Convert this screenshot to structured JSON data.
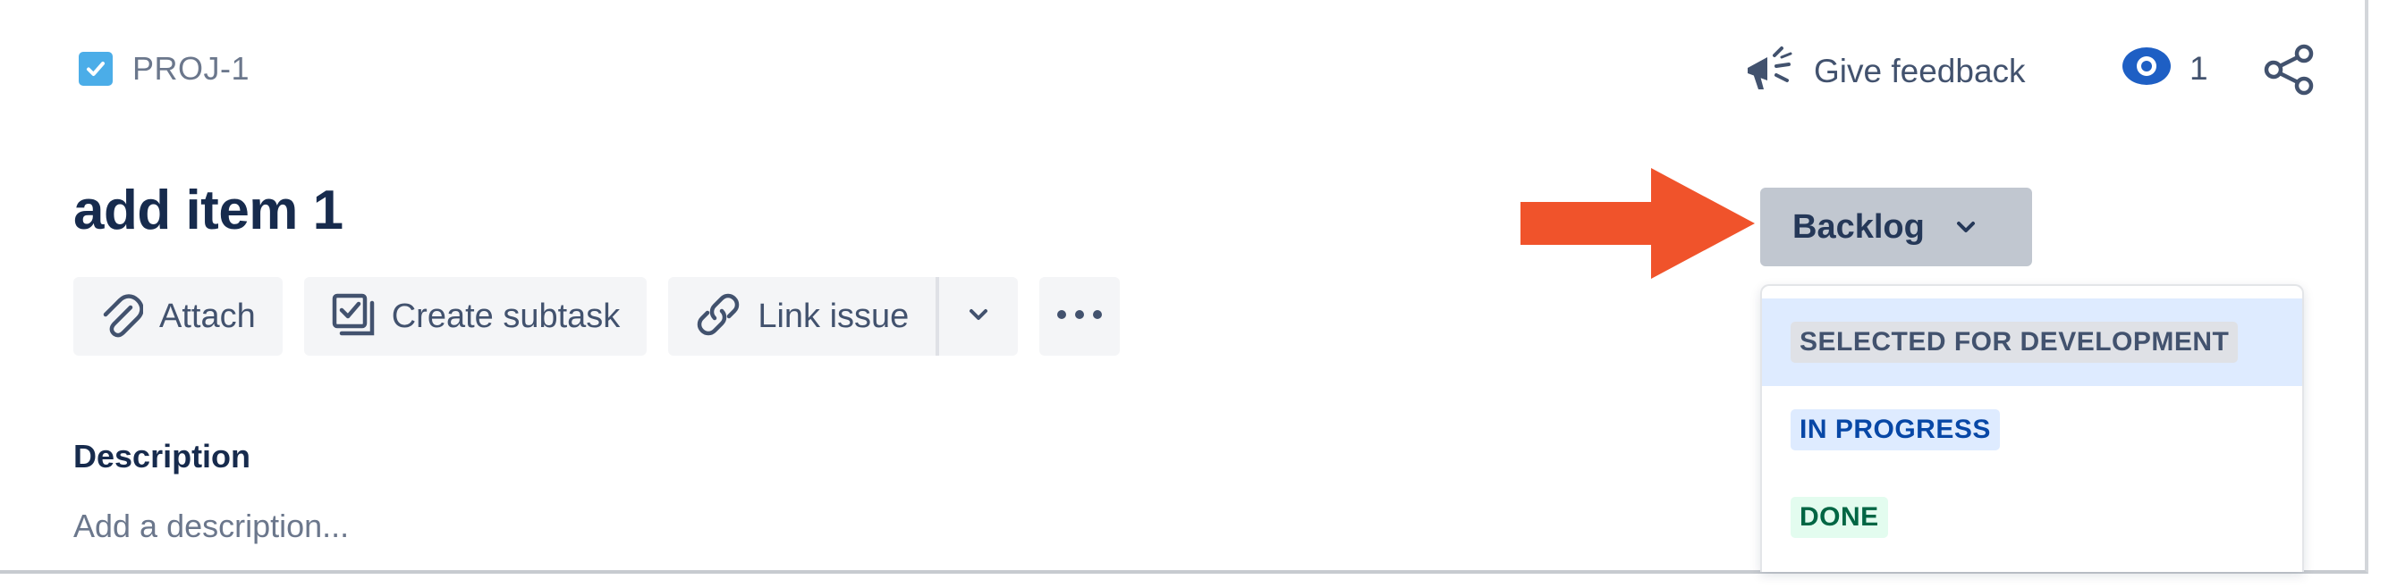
{
  "issue": {
    "key": "PROJ-1",
    "title": "add item 1"
  },
  "header": {
    "feedback_label": "Give feedback",
    "watchers_count": "1"
  },
  "toolbar": {
    "attach_label": "Attach",
    "subtask_label": "Create subtask",
    "link_label": "Link issue"
  },
  "description": {
    "heading": "Description",
    "placeholder": "Add a description..."
  },
  "status": {
    "current": "Backlog",
    "options": [
      {
        "label": "SELECTED FOR DEVELOPMENT",
        "color": "#dfe1e6"
      },
      {
        "label": "IN PROGRESS",
        "color": "#deebff"
      },
      {
        "label": "DONE",
        "color": "#e3fcef"
      }
    ]
  },
  "icons": {
    "issue_type": "checkbox-icon",
    "feedback": "megaphone-icon",
    "watch": "eye-icon",
    "share": "share-icon",
    "attach": "paperclip-icon",
    "subtask": "subtask-icon",
    "link": "link-icon",
    "more": "ellipsis-icon",
    "status_caret": "chevron-down-icon"
  },
  "colors": {
    "arrow": "#f0532b",
    "issue_type": "#4bade8",
    "watch": "#1e5fc4"
  }
}
